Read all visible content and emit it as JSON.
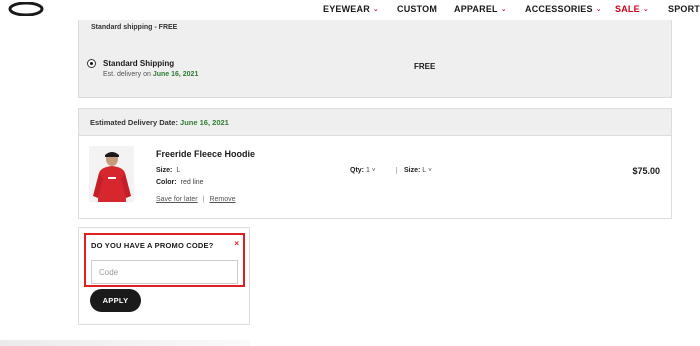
{
  "nav": {
    "brand": "Oakley",
    "items": [
      {
        "label": "EYEWEAR",
        "has_caret": true
      },
      {
        "label": "CUSTOM",
        "has_caret": false
      },
      {
        "label": "APPAREL",
        "has_caret": true
      },
      {
        "label": "ACCESSORIES",
        "has_caret": true
      },
      {
        "label": "SALE",
        "has_caret": true
      },
      {
        "label": "SPORTS",
        "has_caret": false
      }
    ],
    "caret_glyph": "⌄",
    "sale_color": "#d0021b"
  },
  "shipping": {
    "section_heading": "Standard shipping - FREE",
    "option_name": "Standard Shipping",
    "est_prefix": "Est. delivery on",
    "est_date": "June 16, 2021",
    "price": "FREE",
    "selected": true
  },
  "delivery": {
    "label": "Estimated Delivery Date:",
    "date": "June 16, 2021",
    "date_color": "#2f7d32"
  },
  "item": {
    "name": "Freeride Fleece Hoodie",
    "size_label": "Size:",
    "size_value": "L",
    "color_label": "Color:",
    "color_value": "red line",
    "save_for_later": "Save for later",
    "separator": "|",
    "remove": "Remove",
    "qty_label": "Qty:",
    "qty_value": "1",
    "size_select_label": "Size:",
    "size_select_value": "L",
    "chevron_glyph": "˅",
    "price": "$75.00",
    "image_icon": "red-hoodie-model-photo"
  },
  "promo": {
    "title": "DO YOU HAVE A PROMO CODE?",
    "close_glyph": "×",
    "input_placeholder": "Code",
    "input_value": "",
    "apply_label": "APPLY",
    "highlight_color": "#e02020"
  }
}
